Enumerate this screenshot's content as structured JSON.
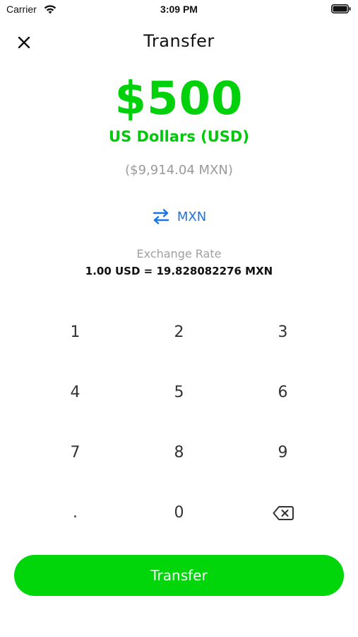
{
  "status_bar": {
    "carrier": "Carrier",
    "time": "3:09 PM",
    "icons": [
      "wifi-icon",
      "battery-icon"
    ]
  },
  "header": {
    "title": "Transfer",
    "close_icon": "close-icon"
  },
  "amount": {
    "value": "$500",
    "currency_name": "US Dollars (USD)",
    "converted": "($9,914.04 MXN)"
  },
  "swap": {
    "icon": "swap-arrows-icon",
    "label": "MXN"
  },
  "exchange_rate": {
    "label": "Exchange Rate",
    "value": "1.00 USD = 19.828082276 MXN"
  },
  "keypad": {
    "keys": [
      "1",
      "2",
      "3",
      "4",
      "5",
      "6",
      "7",
      "8",
      "9",
      ".",
      "0",
      ""
    ],
    "backspace_icon": "backspace-icon"
  },
  "transfer_button": {
    "label": "Transfer"
  },
  "colors": {
    "accent_green": "#00d60a",
    "link_blue": "#1a73e8",
    "muted_gray": "#9a9a9a"
  }
}
